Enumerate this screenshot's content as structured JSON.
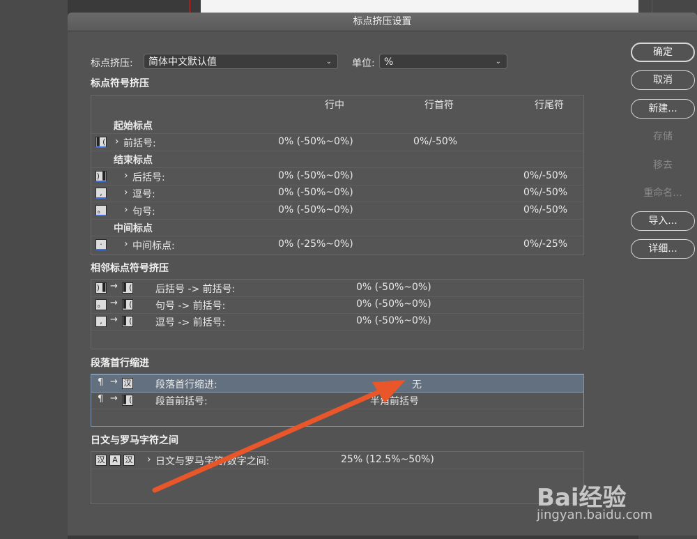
{
  "dialog": {
    "title": "标点挤压设置"
  },
  "top": {
    "mojikumi_label": "标点挤压:",
    "mojikumi_value": "简体中文默认值",
    "unit_label": "单位:",
    "unit_value": "%"
  },
  "punct": {
    "title": "标点符号挤压",
    "columns": [
      "行中",
      "行首符",
      "行尾符"
    ],
    "groups": {
      "open": "起始标点",
      "close": "结束标点",
      "middle": "中间标点"
    },
    "rows": {
      "open_paren": {
        "label": "前括号:",
        "mid": "0% (-50%~0%)",
        "start": "0%/-50%",
        "end": ""
      },
      "close_paren": {
        "label": "后括号:",
        "mid": "0% (-50%~0%)",
        "start": "",
        "end": "0%/-50%"
      },
      "comma": {
        "label": "逗号:",
        "mid": "0% (-50%~0%)",
        "start": "",
        "end": "0%/-50%"
      },
      "period": {
        "label": "句号:",
        "mid": "0% (-50%~0%)",
        "start": "",
        "end": "0%/-50%"
      },
      "middle_dot": {
        "label": "中间标点:",
        "mid": "0% (-25%~0%)",
        "start": "",
        "end": "0%/-25%"
      }
    }
  },
  "adjacent": {
    "title": "相邻标点符号挤压",
    "rows": [
      {
        "label": "后括号 -> 前括号:",
        "value": "0% (-50%~0%)"
      },
      {
        "label": "句号 -> 前括号:",
        "value": "0% (-50%~0%)"
      },
      {
        "label": "逗号 -> 前括号:",
        "value": "0% (-50%~0%)"
      }
    ]
  },
  "indent": {
    "title": "段落首行缩进",
    "rows": [
      {
        "label": "段落首行缩进:",
        "value": "无"
      },
      {
        "label": "段首前括号:",
        "value": "半角前括号"
      }
    ]
  },
  "roman": {
    "title": "日文与罗马字符之间",
    "row": {
      "label": "日文与罗马字符/数字之间:",
      "value": "25% (12.5%~50%)"
    }
  },
  "buttons": {
    "ok": "确定",
    "cancel": "取消",
    "new": "新建...",
    "save": "存储",
    "remove": "移去",
    "rename": "重命名...",
    "import": "导入...",
    "details": "详细..."
  },
  "watermark": {
    "brand": "Bai经验",
    "url": "jingyan.baidu.com"
  },
  "colors": {
    "annotation_arrow": "#e8562a",
    "highlight": "#62707f",
    "dialog_bg": "#535353"
  }
}
